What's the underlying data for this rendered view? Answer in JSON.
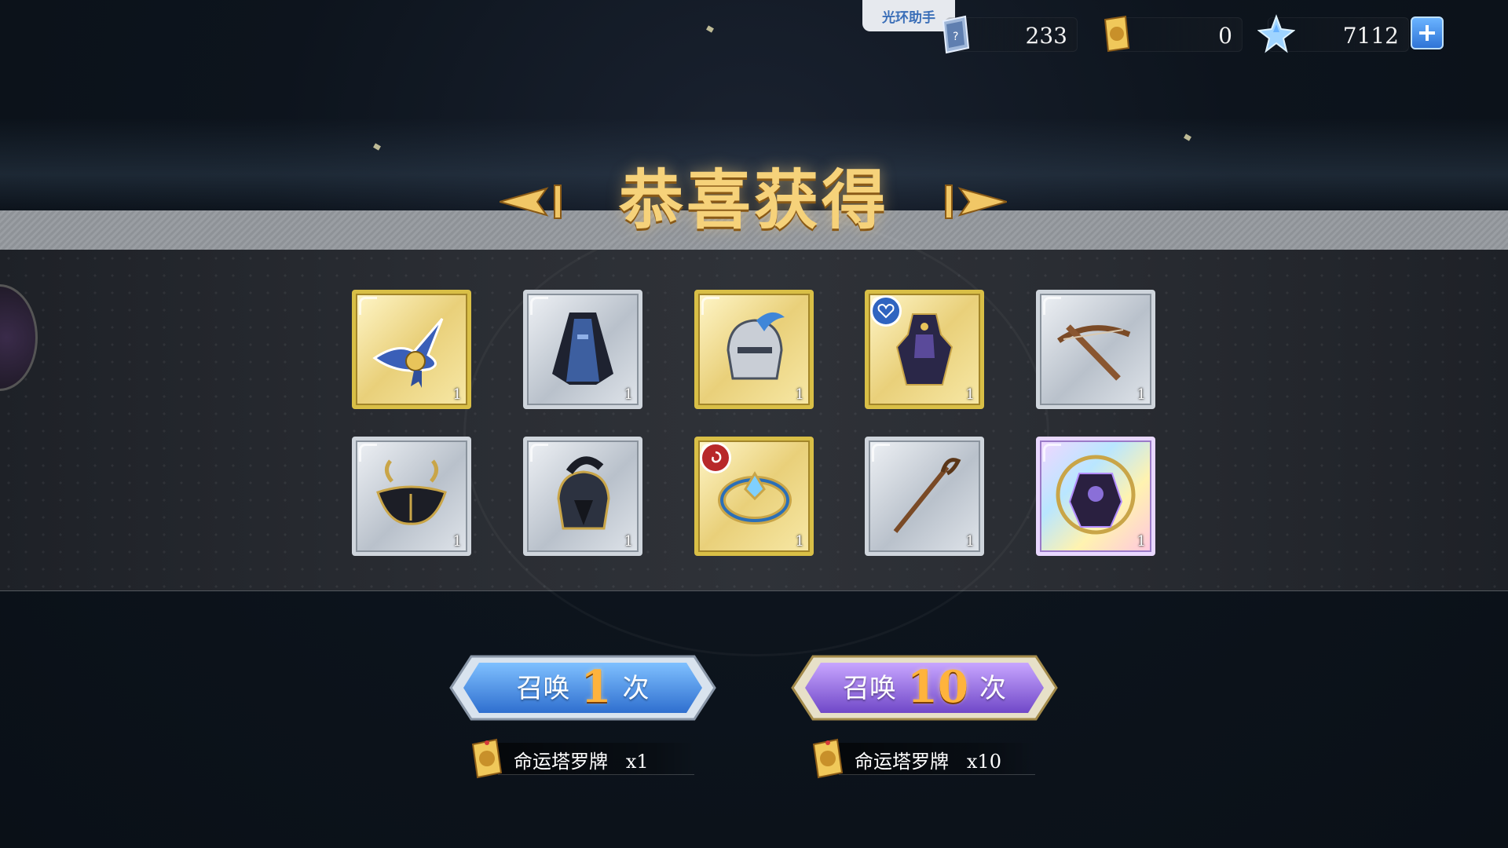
{
  "helper": {
    "label": "光环助手"
  },
  "resources": [
    {
      "name": "summon-ticket",
      "value": "233"
    },
    {
      "name": "tarot-card",
      "value": "0"
    },
    {
      "name": "star-crystal",
      "value": "7112"
    }
  ],
  "banner": {
    "title": "恭喜获得"
  },
  "items": [
    {
      "name": "wizard-hat",
      "rarity": "gold",
      "qty": "1"
    },
    {
      "name": "dark-robe",
      "rarity": "silver",
      "qty": "1"
    },
    {
      "name": "knight-helmet",
      "rarity": "gold",
      "qty": "1"
    },
    {
      "name": "dark-armor-set",
      "rarity": "gold",
      "qty": "1",
      "badge": "blue"
    },
    {
      "name": "crossbow",
      "rarity": "silver",
      "qty": "1"
    },
    {
      "name": "dark-hat",
      "rarity": "silver",
      "qty": "1"
    },
    {
      "name": "spartan-helmet",
      "rarity": "silver",
      "qty": "1"
    },
    {
      "name": "ornate-ring",
      "rarity": "gold",
      "qty": "1",
      "badge": "red"
    },
    {
      "name": "staff",
      "rarity": "silver",
      "qty": "1"
    },
    {
      "name": "dark-knight-emblem",
      "rarity": "rainbow",
      "qty": "1"
    }
  ],
  "summon_once": {
    "prefix": "召唤",
    "count": "1",
    "suffix": "次",
    "cost_label": "命运塔罗牌",
    "cost_qty": "x1"
  },
  "summon_ten": {
    "prefix": "召唤",
    "count": "10",
    "suffix": "次",
    "cost_label": "命运塔罗牌",
    "cost_qty": "x10"
  },
  "colors": {
    "gold_title": "#f6d27a",
    "blue_button": "#4f9bf0",
    "purple_button": "#9b6fe0",
    "count_orange": "#ffb33c"
  }
}
